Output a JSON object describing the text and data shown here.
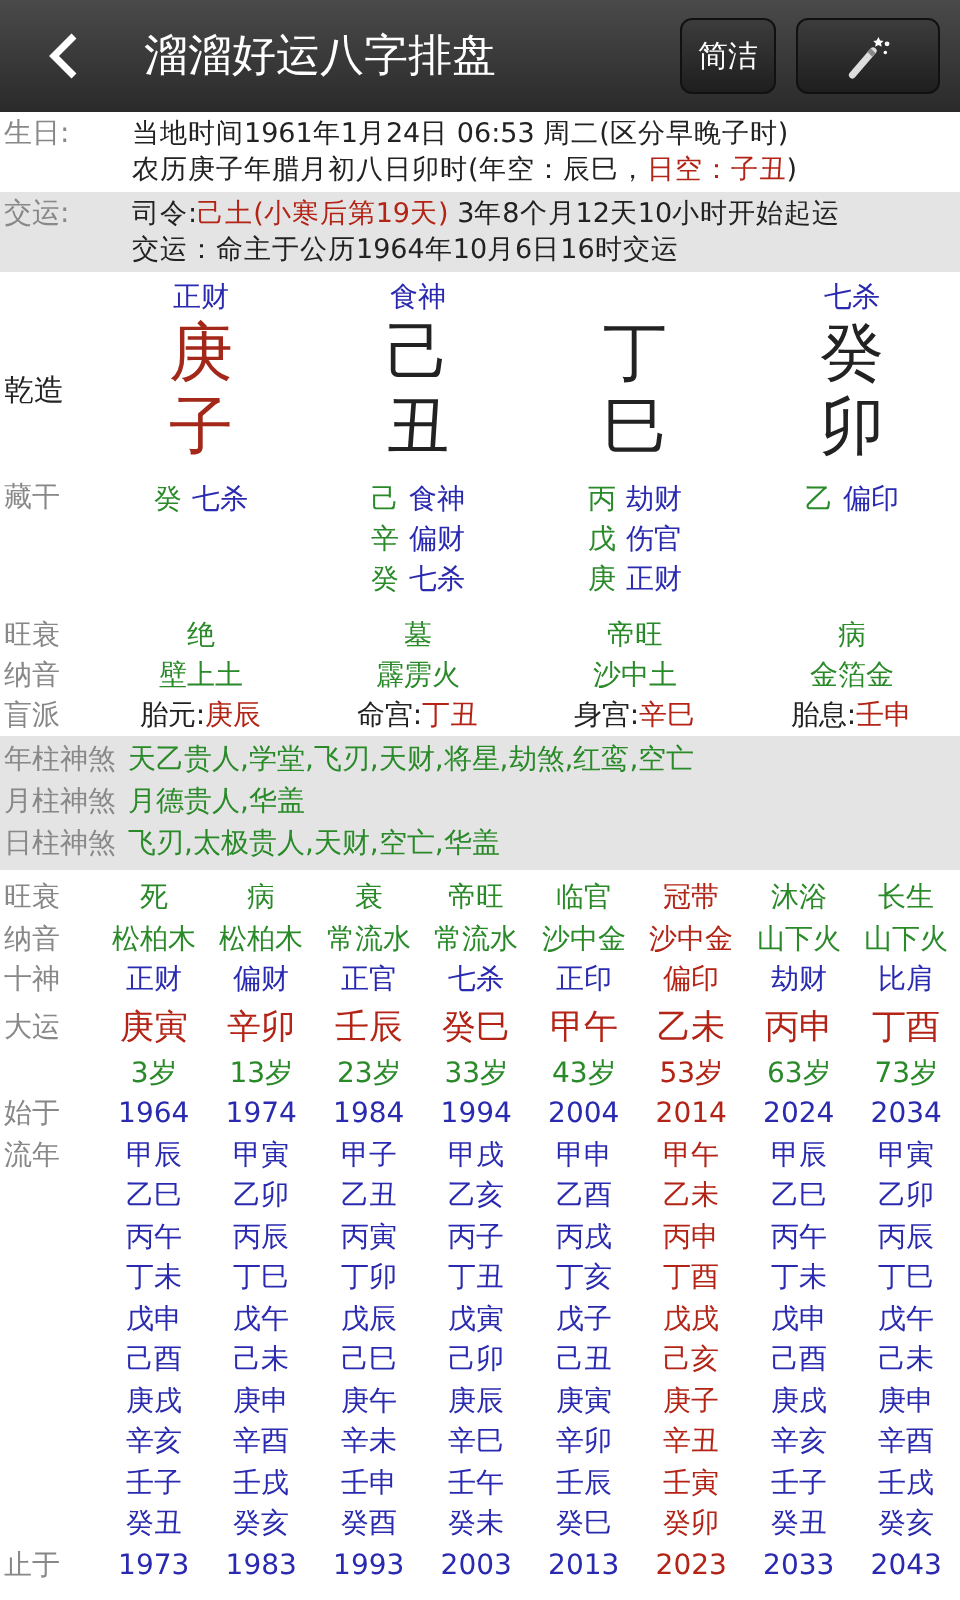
{
  "header": {
    "title": "溜溜好运八字排盘",
    "buttons": [
      {
        "kind": "text",
        "label": "简洁"
      },
      {
        "kind": "wand"
      }
    ]
  },
  "birth": {
    "label": "生日:",
    "lines": [
      [
        {
          "text": "当地时间1961年1月24日 06:53 周二(区分早晚子时)",
          "highlight": false
        }
      ],
      [
        {
          "text": "农历庚子年腊月初八日卯时(年空：辰巳，",
          "highlight": false
        },
        {
          "text": "日空：子丑",
          "highlight": true
        },
        {
          "text": ")",
          "highlight": false
        }
      ]
    ]
  },
  "jiaoyun": {
    "label": "交运:",
    "lines": [
      [
        {
          "text": "司令:",
          "highlight": false
        },
        {
          "text": "己土(小寒后第19天)",
          "highlight": true
        },
        {
          "text": " 3年8个月12天10小时开始起运",
          "highlight": false
        }
      ],
      [
        {
          "text": "交运：命主于公历1964年10月6日16时交运",
          "highlight": false
        }
      ]
    ]
  },
  "chart": {
    "label": "乾造",
    "row_labels": {
      "hidden": "藏干",
      "state": "旺衰",
      "nayin": "纳音",
      "blind": "盲派"
    },
    "pillars": [
      {
        "god": "正财",
        "stem": "庚",
        "branch": "子",
        "color": "#a3281a",
        "hidden": [
          {
            "stem": "癸",
            "god": "七杀"
          }
        ],
        "state": "绝",
        "nayin": "壁上土",
        "blind": {
          "label": "胎元:",
          "value": "庚辰"
        }
      },
      {
        "god": "食神",
        "stem": "己",
        "branch": "丑",
        "color": "#222222",
        "hidden": [
          {
            "stem": "己",
            "god": "食神"
          },
          {
            "stem": "辛",
            "god": "偏财"
          },
          {
            "stem": "癸",
            "god": "七杀"
          }
        ],
        "state": "墓",
        "nayin": "霹雳火",
        "blind": {
          "label": "命宫:",
          "value": "丁丑"
        }
      },
      {
        "stem": "丁",
        "branch": "巳",
        "color": "#222222",
        "hidden": [
          {
            "stem": "丙",
            "god": "劫财"
          },
          {
            "stem": "戊",
            "god": "伤官"
          },
          {
            "stem": "庚",
            "god": "正财"
          }
        ],
        "state": "帝旺",
        "nayin": "沙中土",
        "blind": {
          "label": "身宫:",
          "value": "辛巳"
        }
      },
      {
        "god": "七杀",
        "stem": "癸",
        "branch": "卯",
        "color": "#222222",
        "hidden": [
          {
            "stem": "乙",
            "god": "偏印"
          }
        ],
        "state": "病",
        "nayin": "金箔金",
        "blind": {
          "label": "胎息:",
          "value": "壬申"
        }
      }
    ]
  },
  "shensha": [
    {
      "label": "年柱神煞",
      "value": "天乙贵人,学堂,飞刃,天财,将星,劫煞,红鸾,空亡"
    },
    {
      "label": "月柱神煞",
      "value": "月德贵人,华盖"
    },
    {
      "label": "日柱神煞",
      "value": "飞刃,太极贵人,天财,空亡,华盖"
    }
  ],
  "dayun": {
    "row_labels": {
      "state": "旺衰",
      "nayin": "纳音",
      "god": "十神",
      "pillar": "大运",
      "start": "始于",
      "years": "流年",
      "end": "止于"
    },
    "columns": [
      {
        "selected": false,
        "state": "死",
        "nayin": "松柏木",
        "god": "正财",
        "pillar": "庚寅",
        "age": "3岁",
        "start": "1964",
        "years": [
          "甲辰",
          "乙巳",
          "丙午",
          "丁未",
          "戊申",
          "己酉",
          "庚戌",
          "辛亥",
          "壬子",
          "癸丑"
        ],
        "end": "1973"
      },
      {
        "selected": false,
        "state": "病",
        "nayin": "松柏木",
        "god": "偏财",
        "pillar": "辛卯",
        "age": "13岁",
        "start": "1974",
        "years": [
          "甲寅",
          "乙卯",
          "丙辰",
          "丁巳",
          "戊午",
          "己未",
          "庚申",
          "辛酉",
          "壬戌",
          "癸亥"
        ],
        "end": "1983"
      },
      {
        "selected": false,
        "state": "衰",
        "nayin": "常流水",
        "god": "正官",
        "pillar": "壬辰",
        "age": "23岁",
        "start": "1984",
        "years": [
          "甲子",
          "乙丑",
          "丙寅",
          "丁卯",
          "戊辰",
          "己巳",
          "庚午",
          "辛未",
          "壬申",
          "癸酉"
        ],
        "end": "1993"
      },
      {
        "selected": false,
        "state": "帝旺",
        "nayin": "常流水",
        "god": "七杀",
        "pillar": "癸巳",
        "age": "33岁",
        "start": "1994",
        "years": [
          "甲戌",
          "乙亥",
          "丙子",
          "丁丑",
          "戊寅",
          "己卯",
          "庚辰",
          "辛巳",
          "壬午",
          "癸未"
        ],
        "end": "2003"
      },
      {
        "selected": false,
        "state": "临官",
        "nayin": "沙中金",
        "god": "正印",
        "pillar": "甲午",
        "age": "43岁",
        "start": "2004",
        "years": [
          "甲申",
          "乙酉",
          "丙戌",
          "丁亥",
          "戊子",
          "己丑",
          "庚寅",
          "辛卯",
          "壬辰",
          "癸巳"
        ],
        "end": "2013"
      },
      {
        "selected": true,
        "state": "冠带",
        "nayin": "沙中金",
        "god": "偏印",
        "pillar": "乙未",
        "age": "53岁",
        "start": "2014",
        "years": [
          "甲午",
          "乙未",
          "丙申",
          "丁酉",
          "戊戌",
          "己亥",
          "庚子",
          "辛丑",
          "壬寅",
          "癸卯"
        ],
        "end": "2023"
      },
      {
        "selected": false,
        "state": "沐浴",
        "nayin": "山下火",
        "god": "劫财",
        "pillar": "丙申",
        "age": "63岁",
        "start": "2024",
        "years": [
          "甲辰",
          "乙巳",
          "丙午",
          "丁未",
          "戊申",
          "己酉",
          "庚戌",
          "辛亥",
          "壬子",
          "癸丑"
        ],
        "end": "2033"
      },
      {
        "selected": false,
        "state": "长生",
        "nayin": "山下火",
        "god": "比肩",
        "pillar": "丁酉",
        "age": "73岁",
        "start": "2034",
        "years": [
          "甲寅",
          "乙卯",
          "丙辰",
          "丁巳",
          "戊午",
          "己未",
          "庚申",
          "辛酉",
          "壬戌",
          "癸亥"
        ],
        "end": "2043"
      }
    ]
  }
}
